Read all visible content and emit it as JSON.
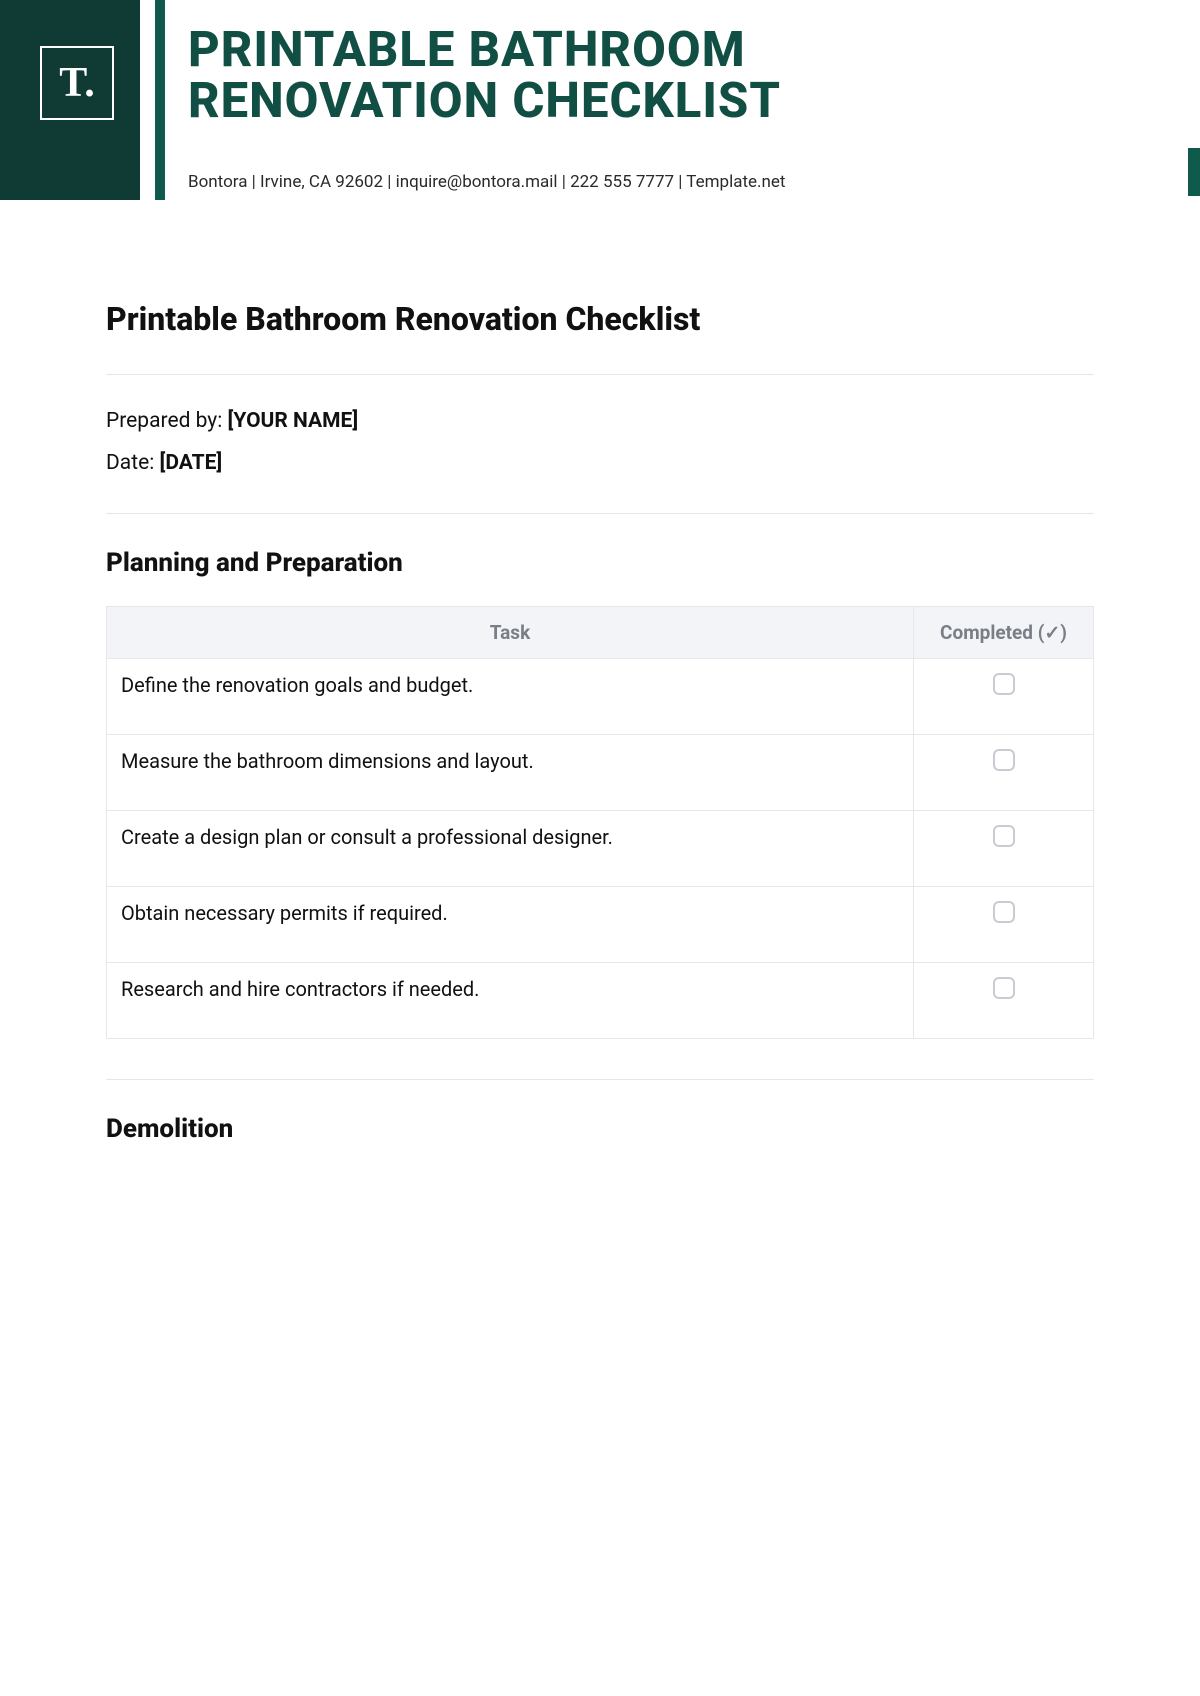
{
  "brand": {
    "logo_text": "T.",
    "accent_dark": "#103b34",
    "accent_green": "#0f5a4a",
    "title_color": "#114e43"
  },
  "header": {
    "title_line1": "PRINTABLE BATHROOM",
    "title_line2": "RENOVATION CHECKLIST",
    "meta": "Bontora | Irvine, CA 92602 | inquire@bontora.mail | 222 555 7777 | Template.net"
  },
  "main": {
    "title": "Printable Bathroom Renovation Checklist",
    "prepared_by_label": "Prepared by: ",
    "prepared_by_value": "[YOUR NAME]",
    "date_label": "Date: ",
    "date_value": "[DATE]"
  },
  "columns": {
    "task": "Task",
    "completed": "Completed (✓)"
  },
  "sections": [
    {
      "title": "Planning and Preparation",
      "tasks": [
        "Define the renovation goals and budget.",
        "Measure the bathroom dimensions and layout.",
        "Create a design plan or consult a professional designer.",
        "Obtain necessary permits if required.",
        "Research and hire contractors if needed."
      ]
    },
    {
      "title": "Demolition",
      "tasks": []
    }
  ]
}
